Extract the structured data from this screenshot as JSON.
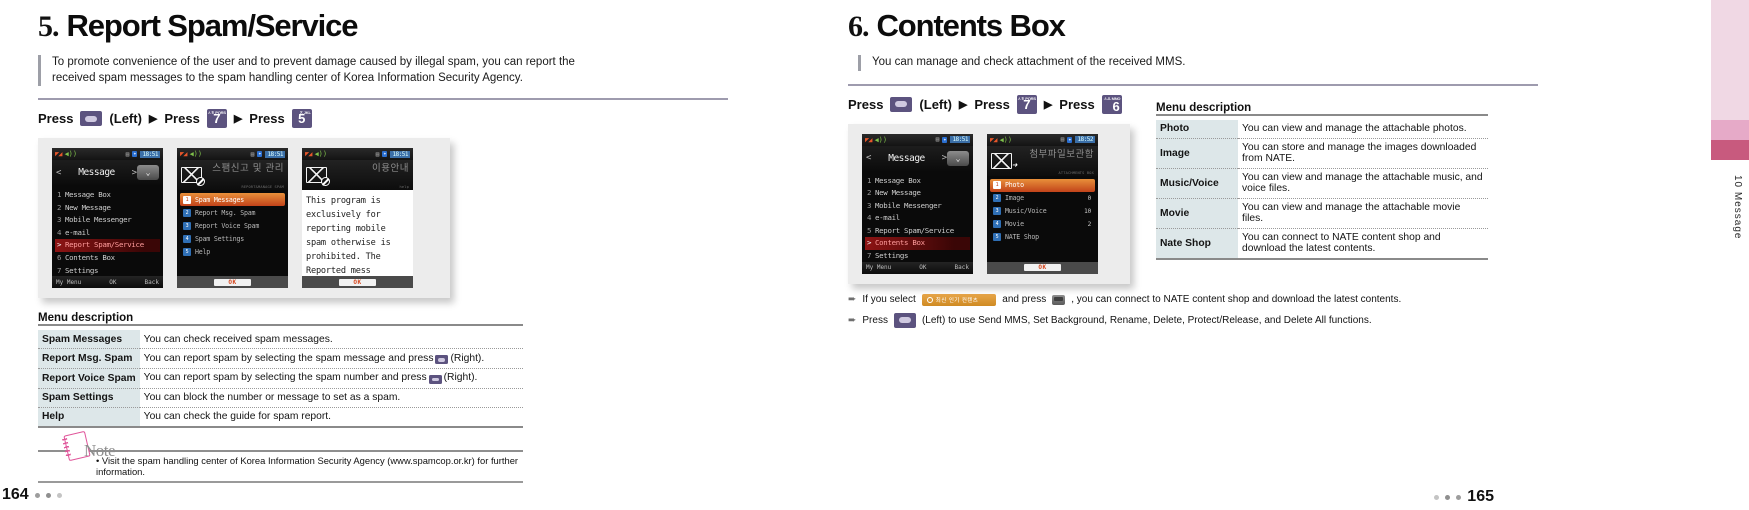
{
  "left": {
    "section_number": "5.",
    "section_title": "Report Spam/Service",
    "intro": "To promote convenience of the user and to prevent damage caused by illegal spam, you can report the received spam messages to the spam handling center of Korea Information Security Agency.",
    "press_sequence": {
      "press_label_1": "Press",
      "nav_label": "(Left)",
      "press_label_2": "Press",
      "key2_digit": "7",
      "key2_sub": "ㅅㅎ\nPQRS",
      "press_label_3": "Press",
      "key3_digit": "5",
      "key3_sub": "ㅈ\nJKL",
      "arrow": "▶"
    },
    "phones": [
      {
        "status": {
          "signal": "signal-icon",
          "speaker": "speaker-icon",
          "lock": "lock-icon",
          "bluetooth": "BT",
          "clock": "18:51"
        },
        "title": "Message",
        "items": [
          {
            "n": "1",
            "label": "Message Box"
          },
          {
            "n": "2",
            "label": "New Message"
          },
          {
            "n": "3",
            "label": "Mobile Messenger"
          },
          {
            "n": "4",
            "label": "e-mail"
          },
          {
            "n": ">",
            "label": "Report Spam/Service",
            "selected": true
          },
          {
            "n": "6",
            "label": "Contents Box"
          },
          {
            "n": "7",
            "label": "Settings"
          }
        ],
        "softkeys": {
          "left": "My Menu",
          "center": "OK",
          "right": "Back"
        }
      },
      {
        "status": {
          "clock": "18:51"
        },
        "banner_ko": "스팸신고 및 관리",
        "banner_en": "REPORT&MANAGE SPAM",
        "items": [
          {
            "n": "1",
            "label": "Spam Messages",
            "selected": true
          },
          {
            "n": "2",
            "label": "Report Msg. Spam"
          },
          {
            "n": "3",
            "label": "Report Voice Spam"
          },
          {
            "n": "4",
            "label": "Spam Settings"
          },
          {
            "n": "5",
            "label": "Help"
          }
        ],
        "ok": "OK"
      },
      {
        "status": {
          "clock": "18:51"
        },
        "banner_ko": "이용안내",
        "banner_en": "help",
        "help_text": "This program is exclusively for reporting mobile spam otherwise is prohibited. The Reported mess",
        "ok": "OK"
      }
    ],
    "menu_description_title": "Menu description",
    "menu_rows": [
      {
        "key": "Spam Messages",
        "desc": "You can check received spam messages."
      },
      {
        "key": "Report Msg. Spam",
        "desc_before": "You can report spam by selecting the spam message and press",
        "desc_after": "(Right).",
        "has_key": true
      },
      {
        "key": "Report Voice Spam",
        "desc_before": "You can report spam by selecting the spam number and press",
        "desc_after": "(Right).",
        "has_key": true
      },
      {
        "key": "Spam Settings",
        "desc": "You can block the number or message to set as a spam."
      },
      {
        "key": "Help",
        "desc": "You can check the guide for spam report."
      }
    ],
    "note_label": "Note",
    "note_text": "• Visit the spam handling center of Korea Information Security Agency (www.spamcop.or.kr) for further information.",
    "page_number": "164"
  },
  "right": {
    "section_number": "6.",
    "section_title": "Contents Box",
    "intro": "You can manage and check attachment of the received MMS.",
    "press_sequence": {
      "press_label_1": "Press",
      "nav_label": "(Left)",
      "press_label_2": "Press",
      "key2_digit": "7",
      "key2_sub": "ㅅㅎ\nPQRS",
      "press_label_3": "Press",
      "key3_digit": "6",
      "key3_sub": "ㅗㅛ\nMNO",
      "arrow": "▶"
    },
    "phones": [
      {
        "status": {
          "clock": "18:51"
        },
        "title": "Message",
        "items": [
          {
            "n": "1",
            "label": "Message Box"
          },
          {
            "n": "2",
            "label": "New Message"
          },
          {
            "n": "3",
            "label": "Mobile Messenger"
          },
          {
            "n": "4",
            "label": "e-mail"
          },
          {
            "n": "5",
            "label": "Report Spam/Service"
          },
          {
            "n": ">",
            "label": "Contents Box",
            "selected": true
          },
          {
            "n": "7",
            "label": "Settings"
          }
        ],
        "softkeys": {
          "left": "My Menu",
          "center": "OK",
          "right": "Back"
        }
      },
      {
        "status": {
          "clock": "18:52"
        },
        "banner_ko": "첨부파일보관함",
        "banner_en": "ATTACHMENTS BOX",
        "items": [
          {
            "n": "1",
            "label": "Photo",
            "count": "",
            "selected": true
          },
          {
            "n": "2",
            "label": "Image",
            "count": "0"
          },
          {
            "n": "3",
            "label": "Music/Voice",
            "count": "10"
          },
          {
            "n": "4",
            "label": "Movie",
            "count": "2"
          },
          {
            "n": "5",
            "label": "NATE Shop",
            "count": ""
          }
        ],
        "ok": "OK"
      }
    ],
    "menu_description_title": "Menu description",
    "menu_rows": [
      {
        "key": "Photo",
        "desc": "You can view and manage the attachable photos."
      },
      {
        "key": "Image",
        "desc": "You can store and manage the images downloaded from NATE."
      },
      {
        "key": "Music/Voice",
        "desc": "You can view and manage the attachable music, and voice files."
      },
      {
        "key": "Movie",
        "desc": "You can view and manage the attachable movie files."
      },
      {
        "key": "Nate Shop",
        "desc": "You can connect to NATE content shop and download the latest contents."
      }
    ],
    "bullets": [
      {
        "before": "If you select",
        "chip_ko": "최신 인기 컨텐츠",
        "middle": "and press",
        "after": ", you can connect to NATE content shop and download the latest contents."
      },
      {
        "before": "Press",
        "after": "(Left) to use Send MMS, Set Background, Rename, Delete, Protect/Release, and Delete All functions."
      }
    ],
    "page_number": "165",
    "rail_label": "10  Message"
  },
  "colors": {
    "key_purple": "#5c537f",
    "rule": "#7d7a93",
    "table_key_bg": "#dde7e9",
    "accent_orange": "#cf8a22",
    "note_pink": "#e0559a"
  }
}
